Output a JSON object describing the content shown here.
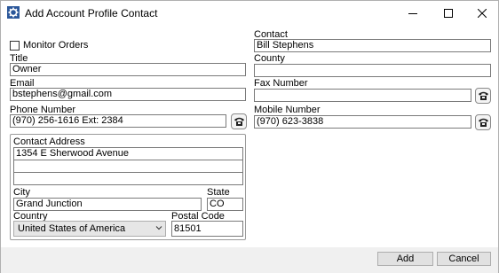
{
  "window": {
    "title": "Add Account Profile Contact"
  },
  "form": {
    "monitor_orders_label": "Monitor Orders",
    "monitor_orders_checked": false,
    "title_label": "Title",
    "title_value": "Owner",
    "email_label": "Email",
    "email_value": "bstephens@gmail.com",
    "phone_label": "Phone Number",
    "phone_value": "(970) 256-1616 Ext: 2384",
    "contact_label": "Contact",
    "contact_value": "Bill Stephens",
    "county_label": "County",
    "county_value": "",
    "fax_label": "Fax Number",
    "fax_value": "",
    "mobile_label": "Mobile Number",
    "mobile_value": "(970) 623-3838"
  },
  "address": {
    "group_label": "Contact Address",
    "line1": "1354 E Sherwood Avenue",
    "line2": "",
    "line3": "",
    "city_label": "City",
    "city_value": "Grand Junction",
    "state_label": "State",
    "state_value": "CO",
    "country_label": "Country",
    "country_value": "United States of America",
    "postal_label": "Postal Code",
    "postal_value": "81501"
  },
  "buttons": {
    "add": "Add",
    "cancel": "Cancel"
  },
  "icons": {
    "app": "gear-icon",
    "phone": "telephone-icon",
    "dropdown": "chevron-down-icon"
  }
}
